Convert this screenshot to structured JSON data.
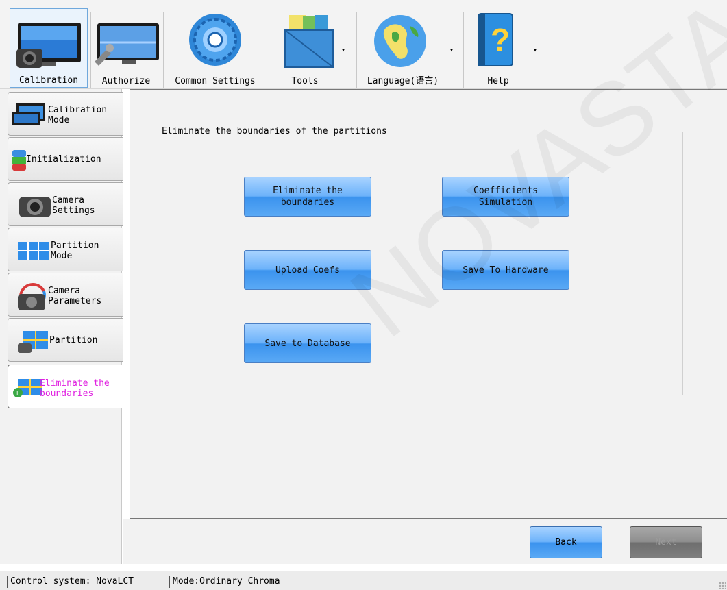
{
  "toolbar": {
    "calibration": "Calibration",
    "authorize": "Authorize",
    "common_settings": "Common Settings",
    "tools": "Tools",
    "language": "Language(语言)",
    "help": "Help"
  },
  "nav": {
    "items": [
      {
        "label": "Calibration\nMode"
      },
      {
        "label": "Initialization"
      },
      {
        "label": "Camera\nSettings"
      },
      {
        "label": "Partition\nMode"
      },
      {
        "label": "Camera\nParameters"
      },
      {
        "label": "Partition"
      },
      {
        "label": "Eliminate the\nboundaries"
      }
    ],
    "active_index": 6
  },
  "main": {
    "group_title": "Eliminate the boundaries of the partitions",
    "buttons": {
      "eliminate": "Eliminate the\nboundaries",
      "coefficients": "Coefficients\nSimulation",
      "upload": "Upload Coefs",
      "save_hardware": "Save To Hardware",
      "save_database": "Save to Database"
    }
  },
  "footer": {
    "back": "Back",
    "next": "Next"
  },
  "status": {
    "control_system": "Control system: NovaLCT",
    "mode": "Mode:Ordinary Chroma"
  },
  "watermark": "NOVASTAR TECH CO.,LTD",
  "colors": {
    "accent_blue": "#5aa9f5",
    "active_nav_text": "#e020e0",
    "disabled_gray": "#7f7f7f"
  },
  "icons": {
    "calibration": "monitor-camera-icon",
    "authorize": "monitor-wrench-icon",
    "common_settings": "gear-icon",
    "tools": "toolbox-icon",
    "language": "globe-icon",
    "help": "help-book-icon"
  }
}
